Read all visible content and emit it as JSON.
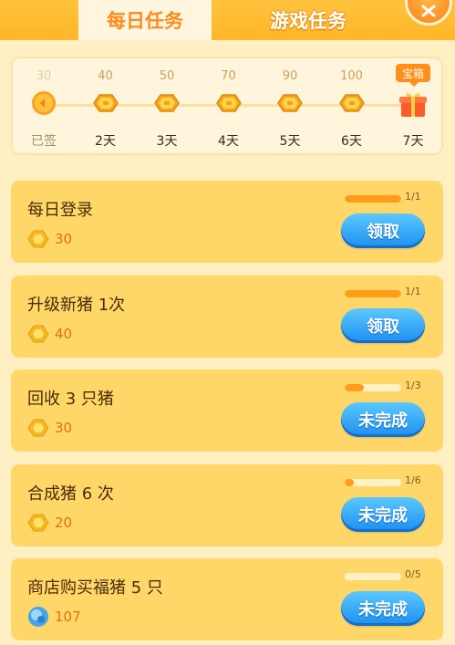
{
  "tabs": [
    {
      "label": "每日任务",
      "active": true
    },
    {
      "label": "游戏任务",
      "active": false
    }
  ],
  "close": {
    "icon": "close-icon"
  },
  "signin": {
    "days": [
      {
        "reward": "30",
        "label": "已签",
        "icon": "signed-coin-icon",
        "done": true
      },
      {
        "reward": "40",
        "label": "2天",
        "icon": "coin-icon",
        "done": false
      },
      {
        "reward": "50",
        "label": "3天",
        "icon": "coin-icon",
        "done": false
      },
      {
        "reward": "70",
        "label": "4天",
        "icon": "coin-icon",
        "done": false
      },
      {
        "reward": "90",
        "label": "5天",
        "icon": "coin-icon",
        "done": false
      },
      {
        "reward": "100",
        "label": "6天",
        "icon": "coin-icon",
        "done": false
      },
      {
        "reward": "宝箱",
        "label": "7天",
        "icon": "gift-box-icon",
        "done": false
      }
    ]
  },
  "tasks": [
    {
      "title": "每日登录",
      "reward": "30",
      "reward_icon": "coin-icon",
      "progress": "1/1",
      "progress_fraction": 1.0,
      "button": "领取"
    },
    {
      "title": "升级新猪 1次",
      "reward": "40",
      "reward_icon": "coin-icon",
      "progress": "1/1",
      "progress_fraction": 1.0,
      "button": "领取"
    },
    {
      "title": "回收 3 只猪",
      "reward": "30",
      "reward_icon": "coin-icon",
      "progress": "1/3",
      "progress_fraction": 0.333,
      "button": "未完成"
    },
    {
      "title": "合成猪 6 次",
      "reward": "20",
      "reward_icon": "coin-icon",
      "progress": "1/6",
      "progress_fraction": 0.167,
      "button": "未完成"
    },
    {
      "title": "商店购买福猪 5 只",
      "reward": "107",
      "reward_icon": "diamond-icon",
      "progress": "0/5",
      "progress_fraction": 0.0,
      "button": "未完成"
    }
  ],
  "colors": {
    "accent": "#ff8a1c",
    "card": "#ffd769",
    "button": "#1c8ff0"
  }
}
